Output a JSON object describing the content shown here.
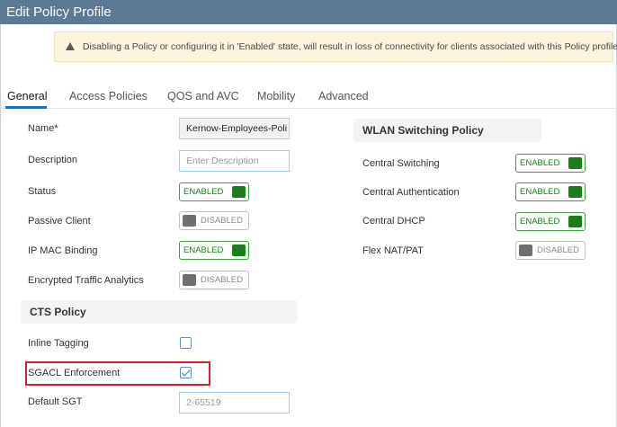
{
  "window": {
    "title": "Edit Policy Profile"
  },
  "warning": {
    "text": "Disabling a Policy or configuring it in 'Enabled' state, will result in loss of connectivity for clients associated with this Policy profile.",
    "icon": "warning-triangle-icon"
  },
  "tabs": [
    "General",
    "Access Policies",
    "QOS and AVC",
    "Mobility",
    "Advanced"
  ],
  "active_tab": "General",
  "left": {
    "name_label": "Name*",
    "name_value": "Kernow-Employees-Poli",
    "description_label": "Description",
    "description_placeholder": "Enter Description",
    "status_label": "Status",
    "status_toggle": "ENABLED",
    "passive_client_label": "Passive Client",
    "passive_client_toggle": "DISABLED",
    "ip_mac_binding_label": "IP MAC Binding",
    "ip_mac_binding_toggle": "ENABLED",
    "eta_label": "Encrypted Traffic Analytics",
    "eta_toggle": "DISABLED"
  },
  "cts": {
    "title": "CTS Policy",
    "inline_tagging_label": "Inline Tagging",
    "inline_tagging_checked": false,
    "sgacl_label": "SGACL Enforcement",
    "sgacl_checked": true,
    "default_sgt_label": "Default SGT",
    "default_sgt_placeholder": "2-65519"
  },
  "wlan": {
    "title": "WLAN Switching Policy",
    "central_switching_label": "Central Switching",
    "central_switching_toggle": "ENABLED",
    "central_auth_label": "Central Authentication",
    "central_auth_toggle": "ENABLED",
    "central_dhcp_label": "Central DHCP",
    "central_dhcp_toggle": "ENABLED",
    "flex_nat_label": "Flex NAT/PAT",
    "flex_nat_toggle": "DISABLED"
  },
  "colors": {
    "titlebar": "#5e7a92",
    "enabled": "#1c7d1c",
    "highlight": "#c8242b",
    "active_tab": "#1e6fb4"
  }
}
